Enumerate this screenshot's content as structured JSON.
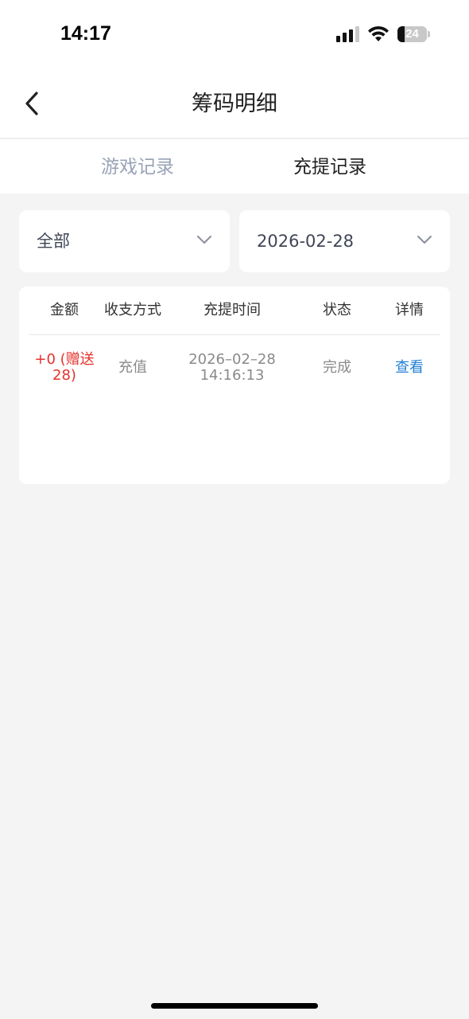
{
  "status_bar": {
    "time": "14:17",
    "battery": "24",
    "battery_level": 0.24
  },
  "nav": {
    "title": "筹码明细",
    "back_icon": "chevron-left-icon"
  },
  "tabs": [
    {
      "label": "游戏记录",
      "active": false
    },
    {
      "label": "充提记录",
      "active": true
    }
  ],
  "filters": {
    "type_value": "全部",
    "date_value": "2026-02-28"
  },
  "table": {
    "columns": [
      "金额",
      "收支方式",
      "充提时间",
      "状态",
      "详情"
    ],
    "rows": [
      {
        "amount": "+0 (赠送28)",
        "method": "充值",
        "time": "2026–02–28 14:16:13",
        "status": "完成",
        "detail": "查看"
      }
    ]
  },
  "colors": {
    "amount": "#e5322d",
    "link": "#1f7fd6",
    "inactive_tab": "#98a3b6",
    "background": "#f4f4f4"
  }
}
